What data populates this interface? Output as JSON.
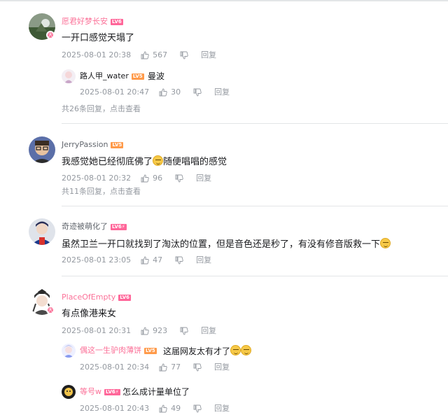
{
  "comments": [
    {
      "username": "愿君好梦长安",
      "level": "LV6",
      "text": "一开口感觉天塌了",
      "time": "2025-08-01 20:38",
      "likes": "567",
      "reply_label": "回复",
      "sub_replies": [
        {
          "username": "路人甲_water",
          "level": "LV5",
          "text": "曼波",
          "time": "2025-08-01 20:47",
          "likes": "30",
          "reply_label": "回复"
        }
      ],
      "more_replies": "共26条回复，点击查看"
    },
    {
      "username": "JerryPassion",
      "level": "LV5",
      "text": "我感觉她已经彻底佛了",
      "text_after_emoji": "随便唱唱的感觉",
      "time": "2025-08-01 20:32",
      "likes": "96",
      "reply_label": "回复",
      "more_replies": "共11条回复，点击查看"
    },
    {
      "username": "奇迹被萌化了",
      "level": "LV6⚡",
      "text": "虽然卫兰一开口就找到了淘汰的位置，但是音色还是秒了，有没有修音版救一下",
      "time": "2025-08-01 23:05",
      "likes": "47",
      "reply_label": "回复"
    },
    {
      "username": "PlaceOfEmpty",
      "level": "LV6",
      "text": "有点像港来女",
      "time": "2025-08-01 20:31",
      "likes": "923",
      "reply_label": "回复",
      "sub_replies": [
        {
          "username": "偶这一生驴肉薄饼",
          "level": "LV5",
          "text": "这届网友太有才了",
          "time": "2025-08-01 20:34",
          "likes": "77",
          "reply_label": "回复"
        },
        {
          "username": "等号w",
          "level": "LV6⚡",
          "text": "怎么成计量单位了",
          "time": "2025-08-01 20:43",
          "likes": "49",
          "reply_label": "回复"
        }
      ]
    }
  ],
  "vip_badge": "大",
  "icons": {
    "like": "thumbs-up-icon",
    "dislike": "thumbs-down-icon",
    "emoji": "doge-emoji-icon"
  },
  "colors": {
    "vip_name": "#fb7299",
    "level6": "#ff6699",
    "level5": "#ff9a4a",
    "meta": "#9499a0"
  }
}
